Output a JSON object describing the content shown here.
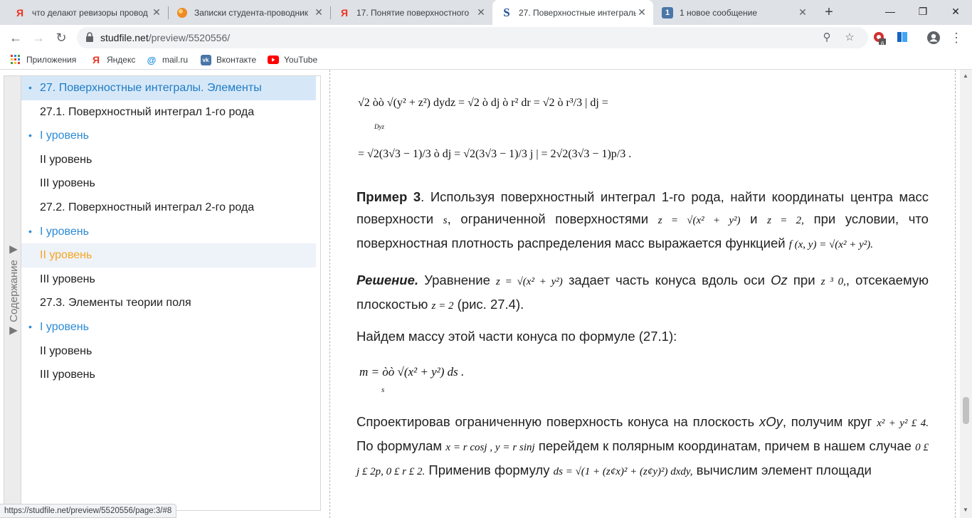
{
  "tabs": [
    {
      "title": "что делают ревизоры провод",
      "icon": "yandex-icon"
    },
    {
      "title": "Записки студента-проводник",
      "icon": "orange-circle-icon"
    },
    {
      "title": "17. Понятие поверхностного",
      "icon": "yandex-icon"
    },
    {
      "title": "27. Поверхностные интеграль",
      "icon": "studfile-icon"
    },
    {
      "title": "1 новое сообщение",
      "icon": "message-badge-icon",
      "badge": "1"
    }
  ],
  "address": {
    "domain": "studfile.net",
    "path": "/preview/5520556/"
  },
  "extension_badge": "6",
  "bookmarks": [
    {
      "label": "Приложения",
      "icon": "apps-grid-icon"
    },
    {
      "label": "Яндекс",
      "icon": "yandex-icon"
    },
    {
      "label": "mail.ru",
      "icon": "mailru-icon"
    },
    {
      "label": "Вконтакте",
      "icon": "vk-icon"
    },
    {
      "label": "YouTube",
      "icon": "youtube-icon"
    }
  ],
  "sidebar": {
    "handle_label": "◀ Содержание ◀",
    "items": [
      {
        "label": "27. Поверхностные интегралы. Элементы",
        "bullet": true,
        "state": "selected"
      },
      {
        "label": "27.1. Поверхностный интеграл 1-го рода",
        "bullet": false,
        "state": "normal"
      },
      {
        "label": "I уровень",
        "bullet": true,
        "state": "link"
      },
      {
        "label": "II уровень",
        "bullet": false,
        "state": "normal"
      },
      {
        "label": "III уровень",
        "bullet": false,
        "state": "normal"
      },
      {
        "label": "27.2. Поверхностный интеграл 2-го рода",
        "bullet": false,
        "state": "normal"
      },
      {
        "label": "I уровень",
        "bullet": true,
        "state": "link"
      },
      {
        "label": "II уровень",
        "bullet": false,
        "state": "current"
      },
      {
        "label": "III уровень",
        "bullet": false,
        "state": "normal"
      },
      {
        "label": "27.3. Элементы теории поля",
        "bullet": false,
        "state": "normal"
      },
      {
        "label": "I уровень",
        "bullet": true,
        "state": "link"
      },
      {
        "label": "II уровень",
        "bullet": false,
        "state": "normal"
      },
      {
        "label": "III уровень",
        "bullet": false,
        "state": "normal"
      }
    ]
  },
  "content": {
    "example_label": "Пример 3",
    "example_text_1": ". Используя поверхностный интеграл 1-го рода, найти координаты центра масс поверхности ",
    "example_text_2": ", ограниченной поверхностями ",
    "example_text_3": " и ",
    "example_text_4": " при условии, что поверхностная плотность распределения масс выражается функцией ",
    "solution_label": "Решение.",
    "solution_text_1": " Уравнение ",
    "solution_text_2": " задает часть конуса вдоль оси ",
    "solution_axis": "Oz",
    "solution_text_3": " при ",
    "solution_text_4": ", отсекаемую плоскостью ",
    "solution_text_5": " (рис. 27.4).",
    "mass_text": "Найдем массу этой части конуса по формуле (27.1):",
    "proj_text_1": "Спроектировав ограниченную поверхность конуса на плоскость ",
    "proj_plane": "xOy",
    "proj_text_2": ", получим круг ",
    "proj_text_3": " По формулам ",
    "proj_text_4": " перейдем к полярным координатам, причем в нашем случае ",
    "proj_text_5": " Применив формулу ",
    "proj_text_6": " вычислим элемент площади",
    "f_sigma": "s",
    "f_cone": "z = √(x² + y²)",
    "f_plane": "z = 2,",
    "f_density": "f (x, y) = √(x² + y²).",
    "f_cone2": "z = √(x² + y²)",
    "f_zge0": "z ³ 0,",
    "f_plane2": "z = 2",
    "f_circle": "x² + y² £ 4.",
    "f_polar": "x = r cosj , y = r sinj",
    "f_bounds": "0 £ j £ 2p, 0 £ r £ 2.",
    "f_ds": "ds = √(1 + (z¢x)² + (z¢y)²) dxdy,",
    "eq1": "√2 òò √(y² + z²) dydz = √2 ò dj ò r² dr = √2 ò r³/3 | dj =",
    "eq1_sub": "Dyz",
    "eq2": "= √2(3√3 − 1)/3 ò dj = √2(3√3 − 1)/3 j | = 2√2(3√3 − 1)p/3 .",
    "eq3": "m = òò √(x² + y²) ds .",
    "eq3_sub": "s"
  },
  "status_url": "https://studfile.net/preview/5520556/page:3/#8"
}
